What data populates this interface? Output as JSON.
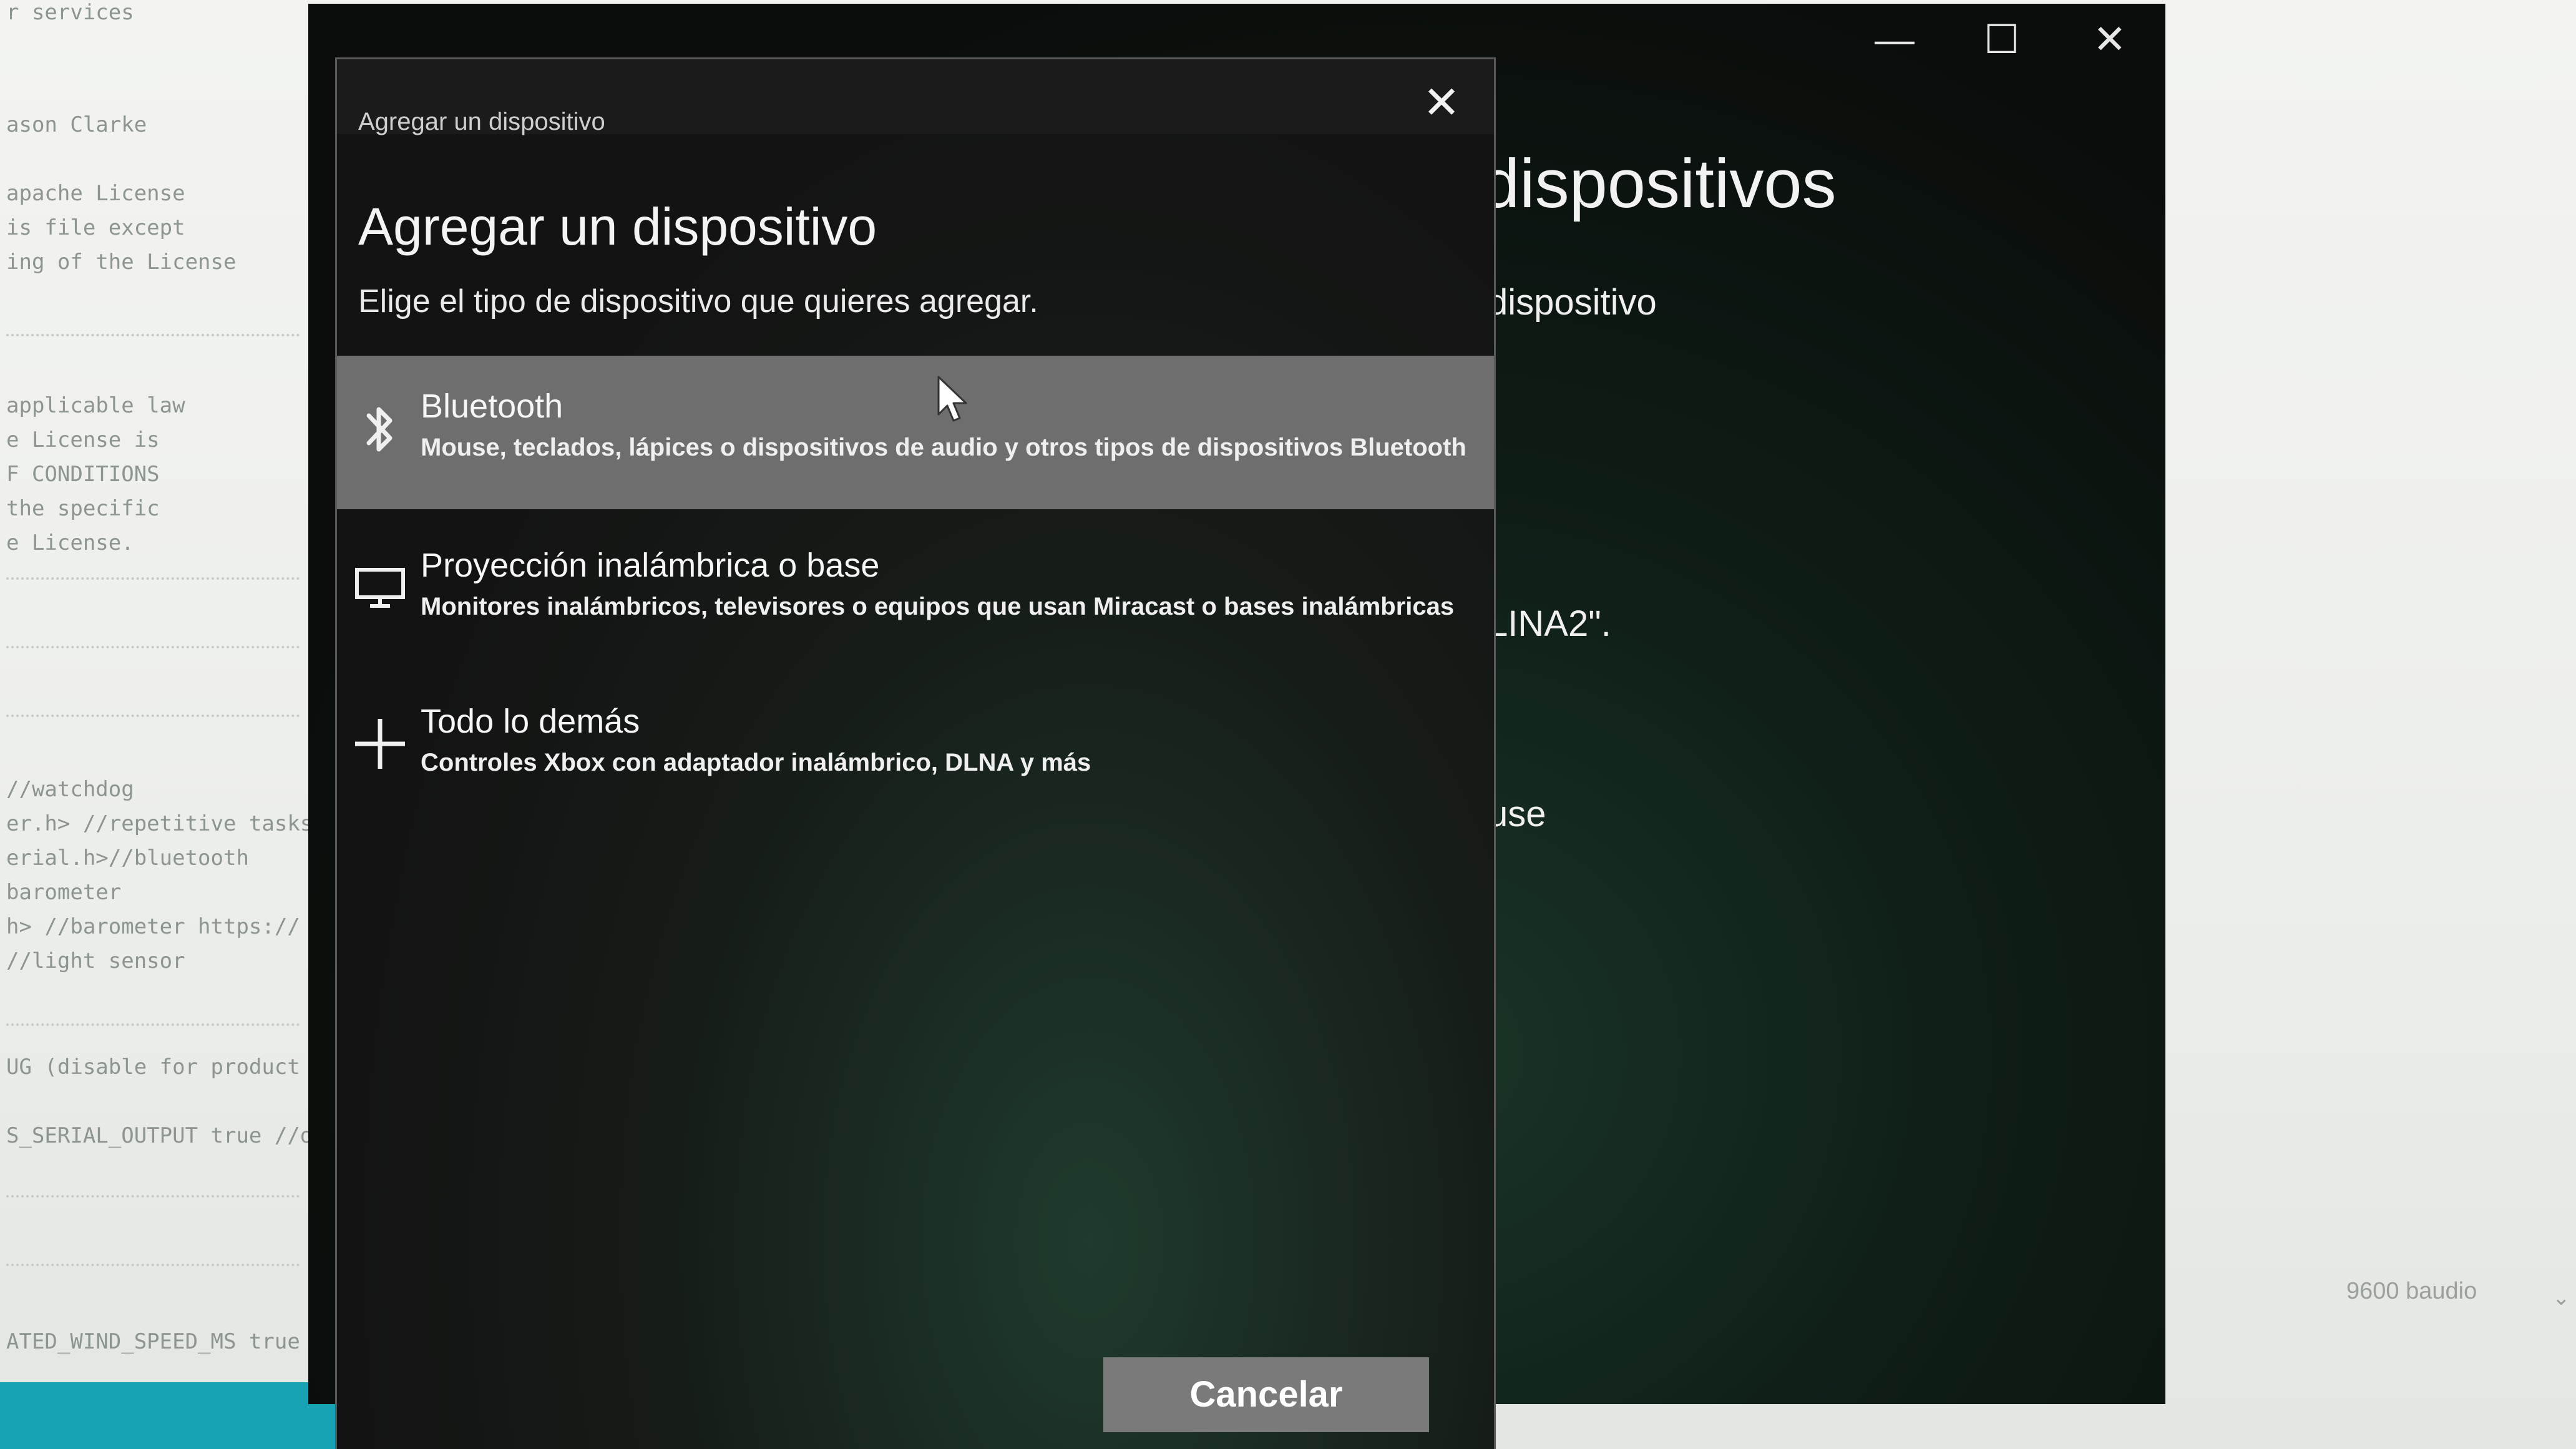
{
  "background_editor": {
    "lines": [
      "r services",
      "ason Clarke",
      "apache License",
      "is file except",
      "ing of the License",
      "",
      "applicable law",
      "e License is",
      "F CONDITIONS",
      "the specific",
      "e License.",
      "",
      "//watchdog",
      "er.h> //repetitive tasks",
      "erial.h>//bluetooth",
      "barometer",
      "h> //barometer https://",
      "//light sensor",
      "",
      "UG (disable for product",
      "S_SERIAL_OUTPUT true //o",
      "",
      "ATED_WIND_SPEED_MS true //"
    ],
    "baud_label": "9600 baudio",
    "baud_chevron": "⌄"
  },
  "settings_window": {
    "title_fragment": "dispositivos",
    "subtitle_fragment": "dispositivo",
    "text_fragment_1": "LINA2\".",
    "text_fragment_2": "use",
    "controls": {
      "minimize": "—",
      "maximize": "☐",
      "close": "✕"
    }
  },
  "dialog": {
    "titlebar_text": "Agregar un dispositivo",
    "close_glyph": "✕",
    "heading": "Agregar un dispositivo",
    "subheading": "Elige el tipo de dispositivo que quieres agregar.",
    "options": [
      {
        "icon": "bluetooth-icon",
        "title": "Bluetooth",
        "description": "Mouse, teclados, lápices o dispositivos de audio y otros tipos de dispositivos Bluetooth",
        "selected": true
      },
      {
        "icon": "monitor-icon",
        "title": "Proyección inalámbrica o base",
        "description": "Monitores inalámbricos, televisores o equipos que usan Miracast o bases inalámbricas",
        "selected": false
      },
      {
        "icon": "plus-icon",
        "title": "Todo lo demás",
        "description": "Controles Xbox con adaptador inalámbrico, DLNA y más",
        "selected": false
      }
    ],
    "cancel_label": "Cancelar"
  }
}
